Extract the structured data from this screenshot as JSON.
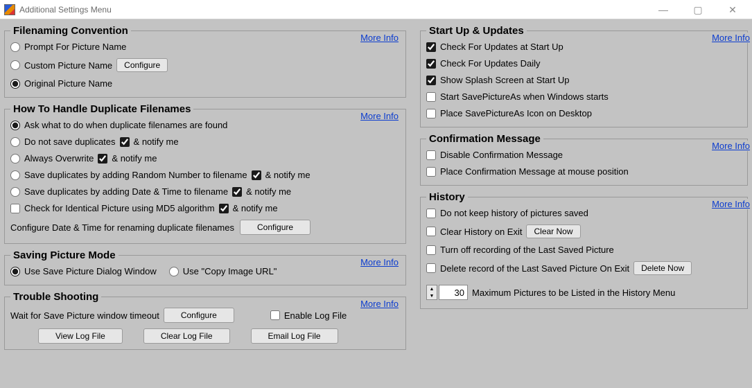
{
  "window": {
    "title": "Additional Settings Menu"
  },
  "more_info": "More Info",
  "filenaming": {
    "legend": "Filenaming Convention",
    "prompt": "Prompt For Picture Name",
    "custom": "Custom Picture Name",
    "configure": "Configure",
    "original": "Original Picture Name",
    "selected": "original"
  },
  "duplicates": {
    "legend": "How To Handle Duplicate Filenames",
    "ask": "Ask what to do when duplicate filenames are found",
    "do_not_save": "Do not save duplicates",
    "always_overwrite": "Always Overwrite",
    "random": "Save duplicates by adding Random Number to filename",
    "datetime": "Save duplicates by adding Date & Time to filename",
    "md5": "Check for Identical Picture using MD5 algorithm",
    "notify": "& notify me",
    "config_dt": "Configure Date & Time for renaming duplicate filenames",
    "configure": "Configure",
    "selected": "ask",
    "notify_do_not_save": true,
    "notify_overwrite": true,
    "notify_random": true,
    "notify_datetime": true,
    "md5_checked": false,
    "notify_md5": true
  },
  "saving": {
    "legend": "Saving Picture Mode",
    "dialog": "Use Save Picture Dialog Window",
    "copyurl": "Use \"Copy Image URL\"",
    "selected": "dialog"
  },
  "trouble": {
    "legend": "Trouble Shooting",
    "timeout": "Wait for Save Picture window timeout",
    "configure": "Configure",
    "enable_log": "Enable Log File",
    "enable_log_checked": false,
    "view_log": "View Log File",
    "clear_log": "Clear Log File",
    "email_log": "Email Log File"
  },
  "startup": {
    "legend": "Start Up & Updates",
    "check_startup": "Check For Updates at Start Up",
    "check_startup_v": true,
    "check_daily": "Check For Updates Daily",
    "check_daily_v": true,
    "splash": "Show Splash Screen at Start Up",
    "splash_v": true,
    "winstart": "Start SavePictureAs when Windows starts",
    "winstart_v": false,
    "desktop_icon": "Place SavePictureAs Icon on Desktop",
    "desktop_icon_v": false
  },
  "confirmation": {
    "legend": "Confirmation Message",
    "disable": "Disable Confirmation Message",
    "disable_v": false,
    "at_mouse": "Place Confirmation Message at mouse position",
    "at_mouse_v": false
  },
  "history": {
    "legend": "History",
    "no_history": "Do not keep history of pictures saved",
    "no_history_v": false,
    "clear_exit": "Clear History on Exit",
    "clear_exit_v": false,
    "clear_now": "Clear Now",
    "turn_off_last": "Turn off recording of the Last Saved Picture",
    "turn_off_last_v": false,
    "delete_last_exit": "Delete record of the Last Saved Picture On Exit",
    "delete_last_exit_v": false,
    "delete_now": "Delete Now",
    "max_pictures": "30",
    "max_pictures_label": "Maximum Pictures to be Listed in the History Menu"
  }
}
